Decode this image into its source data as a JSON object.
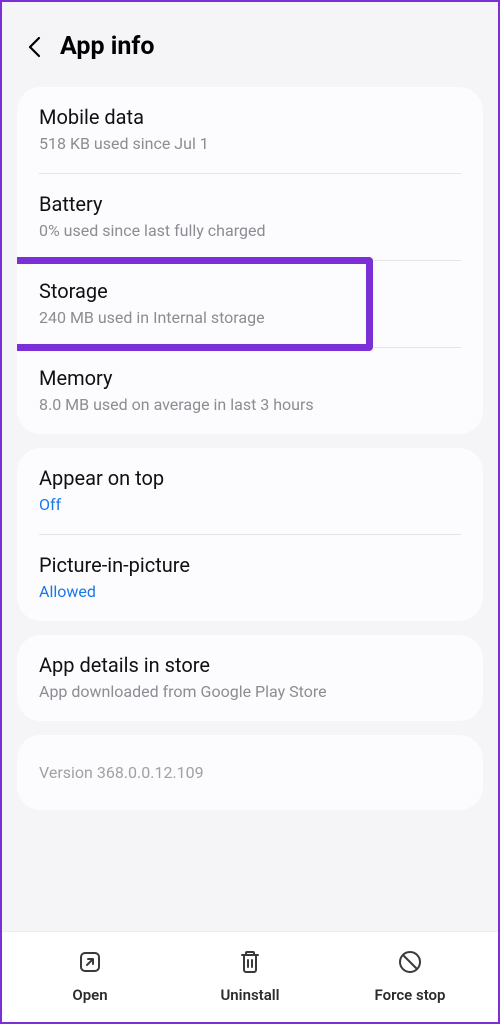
{
  "header": {
    "title": "App info"
  },
  "sections": {
    "usage": {
      "mobile_data": {
        "title": "Mobile data",
        "subtitle": "518 KB used since Jul 1"
      },
      "battery": {
        "title": "Battery",
        "subtitle": "0% used since last fully charged"
      },
      "storage": {
        "title": "Storage",
        "subtitle": "240 MB used in Internal storage"
      },
      "memory": {
        "title": "Memory",
        "subtitle": "8.0 MB used on average in last 3 hours"
      }
    },
    "display": {
      "appear_on_top": {
        "title": "Appear on top",
        "value": "Off"
      },
      "pip": {
        "title": "Picture-in-picture",
        "value": "Allowed"
      }
    },
    "details": {
      "title": "App details in store",
      "subtitle": "App downloaded from Google Play Store"
    },
    "version": "Version 368.0.0.12.109"
  },
  "actions": {
    "open": "Open",
    "uninstall": "Uninstall",
    "force_stop": "Force stop"
  }
}
